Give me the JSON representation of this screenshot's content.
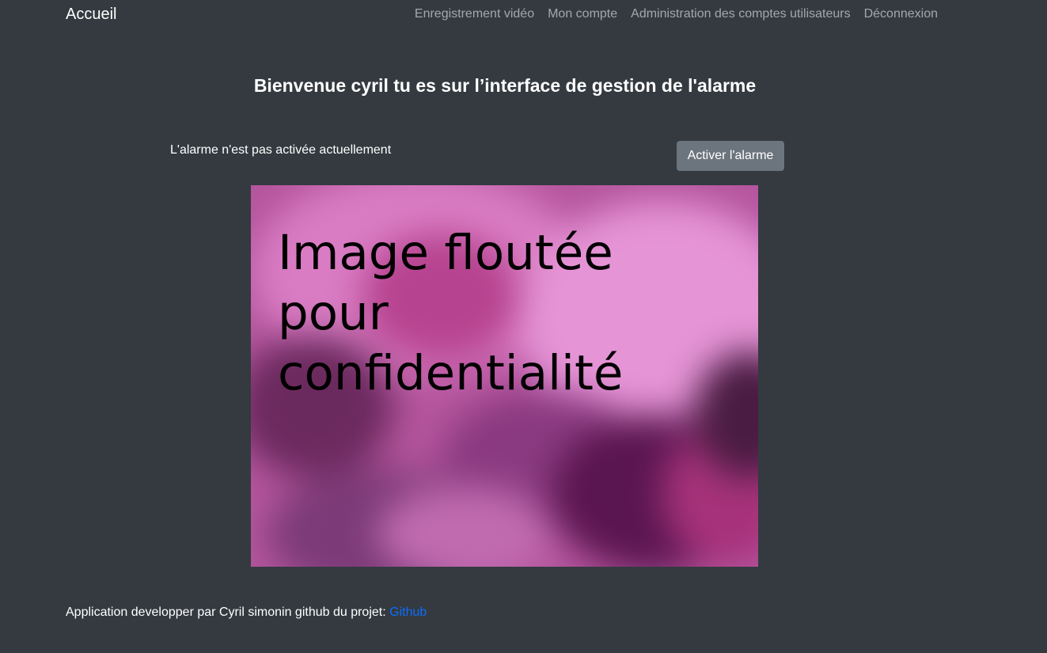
{
  "navbar": {
    "brand": "Accueil",
    "links": [
      {
        "label": "Enregistrement vidéo"
      },
      {
        "label": "Mon compte"
      },
      {
        "label": "Administration des comptes utilisateurs"
      },
      {
        "label": "Déconnexion"
      }
    ]
  },
  "main": {
    "title": "Bienvenue cyril tu es sur l’interface de gestion de l'alarme",
    "alarm_status": "L'alarme n'est pas activée actuellement",
    "activate_button": "Activer l'alarme",
    "camera_overlay_text": "Image floutée pour confidentialité"
  },
  "footer": {
    "text": "Application developper par Cyril simonin github du projet: ",
    "link_label": "Github"
  },
  "colors": {
    "background": "#343a40",
    "button": "#6c757d",
    "link": "#0d6efd",
    "nav_link": "rgba(255,255,255,0.55)"
  }
}
